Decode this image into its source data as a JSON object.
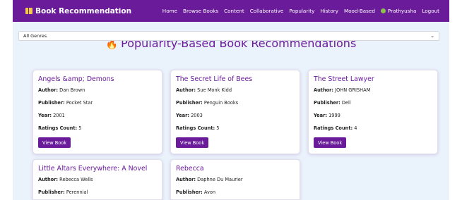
{
  "navbar": {
    "brand": "Book Recommendation",
    "links": [
      "Home",
      "Browse Books",
      "Content",
      "Collaborative",
      "Popularity",
      "History",
      "Mood-Based"
    ],
    "user": "Prathyusha",
    "logout": "Logout",
    "color": "#6a1b9a"
  },
  "page": {
    "title": "Popularity-Based Book Recommendations",
    "genre_selected": "All Genres"
  },
  "labels": {
    "author": "Author:",
    "publisher": "Publisher:",
    "year": "Year:",
    "ratings": "Ratings Count:",
    "view_button": "View Book"
  },
  "books": [
    {
      "title": "Angels &amp; Demons",
      "author": "Dan Brown",
      "publisher": "Pocket Star",
      "year": "2001",
      "ratings": "5"
    },
    {
      "title": "The Secret Life of Bees",
      "author": "Sue Monk Kidd",
      "publisher": "Penguin Books",
      "year": "2003",
      "ratings": "5"
    },
    {
      "title": "The Street Lawyer",
      "author": "JOHN GRISHAM",
      "publisher": "Dell",
      "year": "1999",
      "ratings": "4"
    },
    {
      "title": "Little Altars Everywhere: A Novel",
      "author": "Rebecca Wells",
      "publisher": "Perennial"
    },
    {
      "title": "Rebecca",
      "author": "Daphne Du Maurier",
      "publisher": "Avon"
    }
  ]
}
